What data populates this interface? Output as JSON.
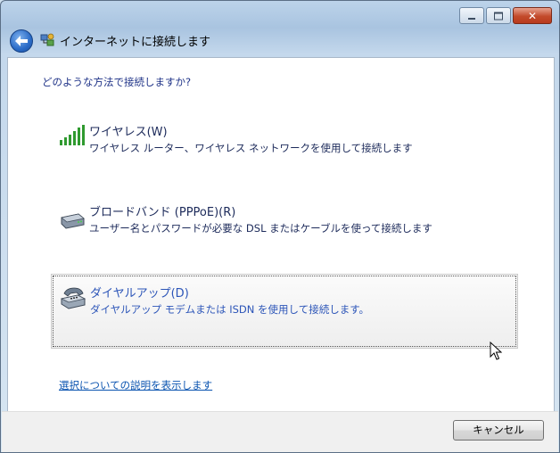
{
  "window": {
    "title": "インターネットに接続します",
    "controls": [
      "minimize",
      "maximize",
      "close"
    ],
    "close_glyph": "✕"
  },
  "question": "どのような方法で接続しますか?",
  "options": [
    {
      "title": "ワイヤレス(W)",
      "description": "ワイヤレス ルーター、ワイヤレス ネットワークを使用して接続します",
      "icon": "wireless-signal-icon"
    },
    {
      "title": "ブロードバンド (PPPoE)(R)",
      "description": "ユーザー名とパスワードが必要な DSL またはケーブルを使って接続します",
      "icon": "broadband-modem-icon"
    },
    {
      "title": "ダイヤルアップ(D)",
      "description": "ダイヤルアップ モデムまたは ISDN を使用して接続します。",
      "icon": "dialup-phone-icon",
      "selected": true
    }
  ],
  "help_link": "選択についての説明を表示します",
  "footer": {
    "cancel_label": "キャンセル"
  },
  "colors": {
    "accent": "#2c55b8",
    "link": "#0b54b0",
    "text": "#1c2a5a"
  }
}
